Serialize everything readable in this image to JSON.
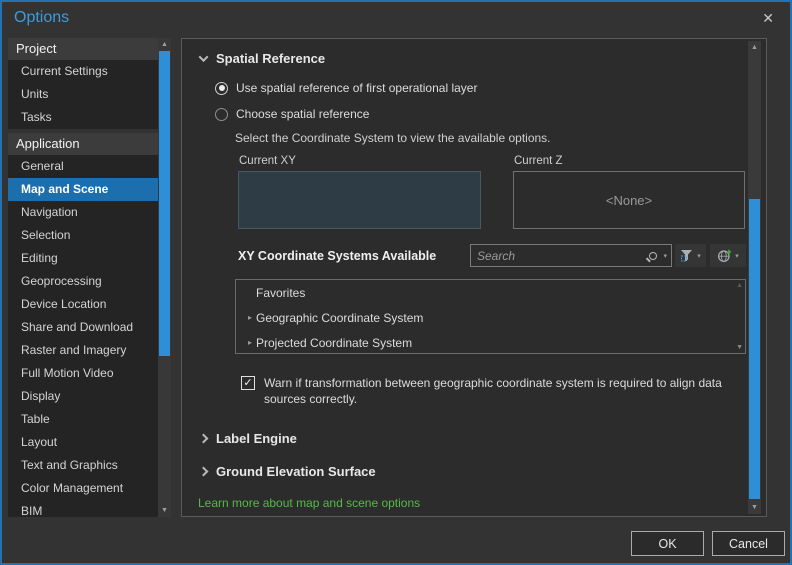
{
  "window": {
    "title": "Options"
  },
  "icons": {
    "close": "✕",
    "check": "✓",
    "caret_down": "▾",
    "arrow_up": "▲",
    "arrow_down": "▼",
    "tree_expander": "▸"
  },
  "sidebar": {
    "sections": [
      {
        "header": "Project",
        "items": [
          {
            "label": "Current Settings"
          },
          {
            "label": "Units"
          },
          {
            "label": "Tasks"
          }
        ]
      },
      {
        "header": "Application",
        "items": [
          {
            "label": "General"
          },
          {
            "label": "Map and Scene",
            "selected": true
          },
          {
            "label": "Navigation"
          },
          {
            "label": "Selection"
          },
          {
            "label": "Editing"
          },
          {
            "label": "Geoprocessing"
          },
          {
            "label": "Device Location"
          },
          {
            "label": "Share and Download"
          },
          {
            "label": "Raster and Imagery"
          },
          {
            "label": "Full Motion Video"
          },
          {
            "label": "Display"
          },
          {
            "label": "Table"
          },
          {
            "label": "Layout"
          },
          {
            "label": "Text and Graphics"
          },
          {
            "label": "Color Management"
          },
          {
            "label": "BIM"
          }
        ]
      }
    ]
  },
  "content": {
    "spatial_reference": {
      "title": "Spatial Reference",
      "radio_first": "Use spatial reference of first operational layer",
      "radio_choose": "Choose spatial reference",
      "hint": "Select the Coordinate System to view the available options.",
      "current_xy_label": "Current XY",
      "current_z_label": "Current Z",
      "current_z_value": "<None>",
      "xy_available_label": "XY Coordinate Systems Available",
      "search_placeholder": "Search",
      "list": [
        {
          "label": "Favorites"
        },
        {
          "label": "Geographic Coordinate System"
        },
        {
          "label": "Projected Coordinate System"
        }
      ],
      "warn_text": "Warn if transformation between geographic coordinate system is required to align data sources correctly."
    },
    "collapsed_sections": [
      {
        "title": "Label Engine"
      },
      {
        "title": "Ground Elevation Surface"
      }
    ],
    "learn_more": "Learn more about map and scene options"
  },
  "footer": {
    "ok": "OK",
    "cancel": "Cancel"
  },
  "colors": {
    "accent_selected": "#1D6EAD",
    "scrollbar_thumb": "#2E8FD8",
    "title_blue": "#3E9BDC",
    "dialog_border": "#2273B5",
    "link_green": "#55B94A",
    "current_xy_fill": "#2E3D45"
  }
}
